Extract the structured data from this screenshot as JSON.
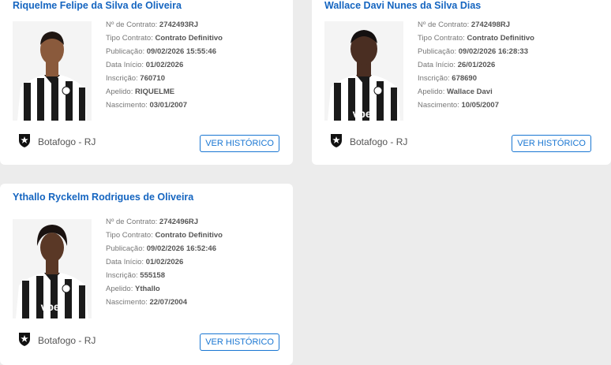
{
  "labels": {
    "contract_no": "Nº de Contrato:",
    "contract_type": "Tipo Contrato:",
    "published": "Publicação:",
    "start_date": "Data Início:",
    "registration": "Inscrição:",
    "nickname": "Apelido:",
    "birth": "Nascimento:"
  },
  "players": [
    {
      "name": "Riquelme Felipe da Silva de Oliveira",
      "contract_no": "2742493RJ",
      "contract_type": "Contrato Definitivo",
      "published": "09/02/2026 15:55:46",
      "start_date": "01/02/2026",
      "registration": "760710",
      "nickname": "RIQUELME",
      "birth": "03/01/2007",
      "club": "Botafogo - RJ",
      "button": "VER HISTÓRICO"
    },
    {
      "name": "Wallace Davi Nunes da Silva Dias",
      "contract_no": "2742498RJ",
      "contract_type": "Contrato Definitivo",
      "published": "09/02/2026 16:28:33",
      "start_date": "26/01/2026",
      "registration": "678690",
      "nickname": "Wallace Davi",
      "birth": "10/05/2007",
      "club": "Botafogo - RJ",
      "button": "VER HISTÓRICO"
    },
    {
      "name": "Ythallo Ryckelm Rodrigues de Oliveira",
      "contract_no": "2742496RJ",
      "contract_type": "Contrato Definitivo",
      "published": "09/02/2026 16:52:46",
      "start_date": "01/02/2026",
      "registration": "555158",
      "nickname": "Ythallo",
      "birth": "22/07/2004",
      "club": "Botafogo - RJ",
      "button": "VER HISTÓRICO"
    }
  ],
  "sponsor_text": "vbet",
  "colors": {
    "link": "#1565c0",
    "button": "#1976d2",
    "background": "#ececec"
  }
}
